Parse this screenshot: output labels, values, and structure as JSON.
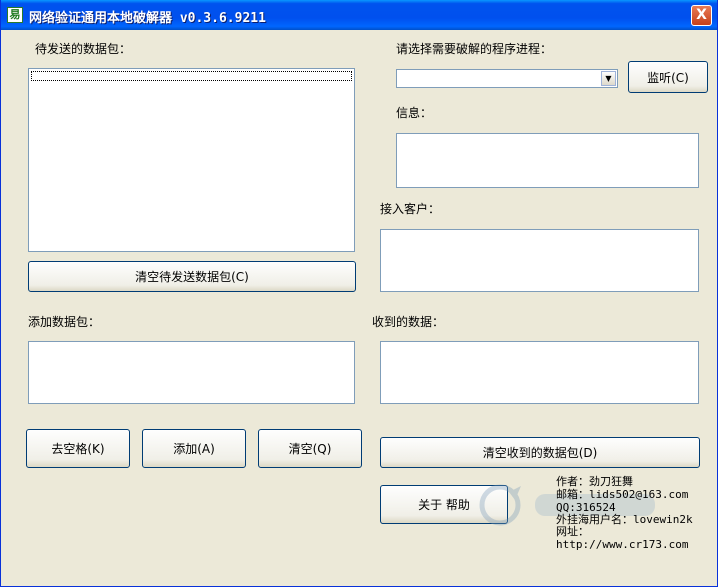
{
  "window": {
    "title": "网络验证通用本地破解器 v0.3.6.9211",
    "close_label": "X",
    "icon_label": "易"
  },
  "left": {
    "pending_label": "待发送的数据包：",
    "clear_pending_button": "清空待发送数据包(C)",
    "add_label": "添加数据包：",
    "trim_button": "去空格(K)",
    "add_button": "添加(A)",
    "clear_button": "清空(Q)",
    "about_button": "关于 帮助"
  },
  "right": {
    "process_label": "请选择需要破解的程序进程：",
    "listen_button": "监听(C)",
    "info_label": "信息：",
    "client_label": "接入客户：",
    "received_label": "收到的数据：",
    "clear_received_button": "清空收到的数据包(D)"
  },
  "credits": {
    "author": "作者：劲刀狂舞",
    "email": "邮箱：lids502@163.com",
    "qq": "QQ:316524",
    "forum_user": "外挂海用户名：lovewin2k",
    "site_label": "网址：",
    "site_url": "http://www.cr173.com"
  }
}
